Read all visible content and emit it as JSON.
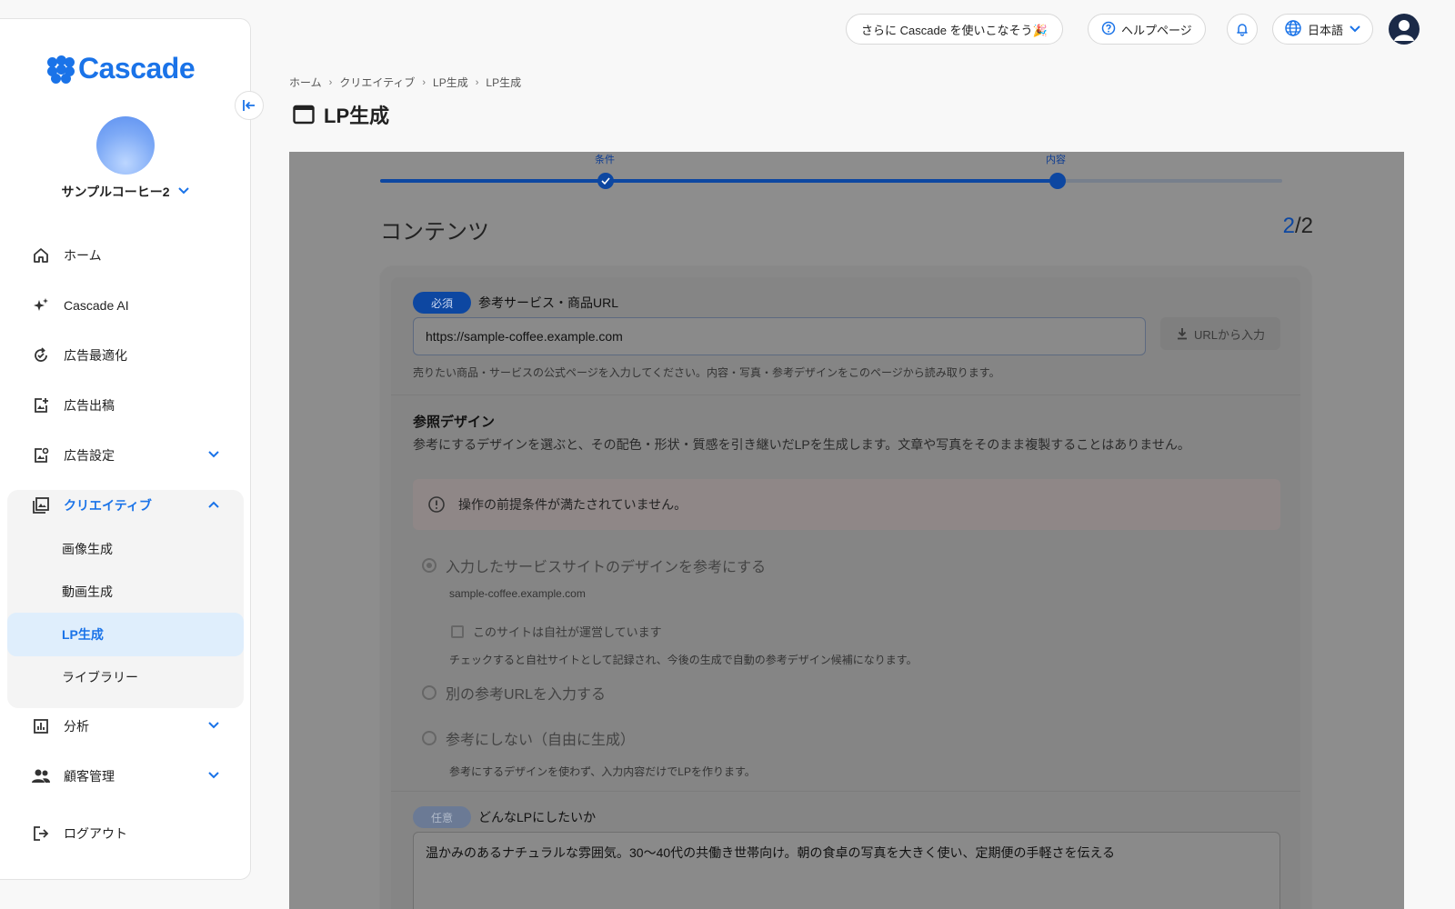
{
  "brand": {
    "name": "Cascade"
  },
  "sidebar": {
    "account_name": "サンプルコーヒー2",
    "items": [
      {
        "label": "ホーム"
      },
      {
        "label": "Cascade AI"
      },
      {
        "label": "広告最適化"
      },
      {
        "label": "広告出稿"
      },
      {
        "label": "広告設定"
      },
      {
        "label": "クリエイティブ"
      },
      {
        "label": "分析"
      },
      {
        "label": "顧客管理"
      },
      {
        "label": "ログアウト"
      }
    ],
    "sub_items": [
      {
        "label": "画像生成"
      },
      {
        "label": "動画生成"
      },
      {
        "label": "LP生成"
      },
      {
        "label": "ライブラリー"
      }
    ]
  },
  "header": {
    "promo_label": "さらに Cascade を使いこなそう🎉",
    "help_label": "ヘルプページ",
    "language": "日本語"
  },
  "breadcrumb": [
    "ホーム",
    "クリエイティブ",
    "LP生成",
    "LP生成"
  ],
  "page": {
    "title": "LP生成"
  },
  "stepper": {
    "steps": [
      {
        "label": "条件",
        "done": true
      },
      {
        "label": "内容",
        "done": false
      }
    ],
    "progress": 0.75
  },
  "content": {
    "section_title": "コンテンツ",
    "counter_current": "2",
    "counter_total": "/2",
    "url_field": {
      "badge": "必須",
      "label": "参考サービス・商品URL",
      "value": "https://sample-coffee.example.com",
      "button": "URLから入力",
      "hint": "売りたい商品・サービスの公式ページを入力してください。内容・写真・参考デザインをこのページから読み取ります。"
    },
    "design": {
      "title": "参照デザイン",
      "description": "参考にするデザインを選ぶと、その配色・形状・質感を引き継いだLPを生成します。文章や写真をそのまま複製することはありません。",
      "alert": "操作の前提条件が満たされていません。",
      "option1": "入力したサービスサイトのデザインを参考にする",
      "option1_domain": "sample-coffee.example.com",
      "own_site_check": "このサイトは自社が運営しています",
      "own_site_hint": "チェックすると自社サイトとして記録され、今後の生成で自動の参考デザイン候補になります。",
      "option2": "別の参考URLを入力する",
      "option3": "参考にしない（自由に生成）",
      "option3_hint": "参考にするデザインを使わず、入力内容だけでLPを作ります。"
    },
    "wish": {
      "badge": "任意",
      "label": "どんなLPにしたいか",
      "value": "温かみのあるナチュラルな雰囲気。30〜40代の共働き世帯向け。朝の食卓の写真を大きく使い、定期便の手軽さを伝える"
    }
  }
}
